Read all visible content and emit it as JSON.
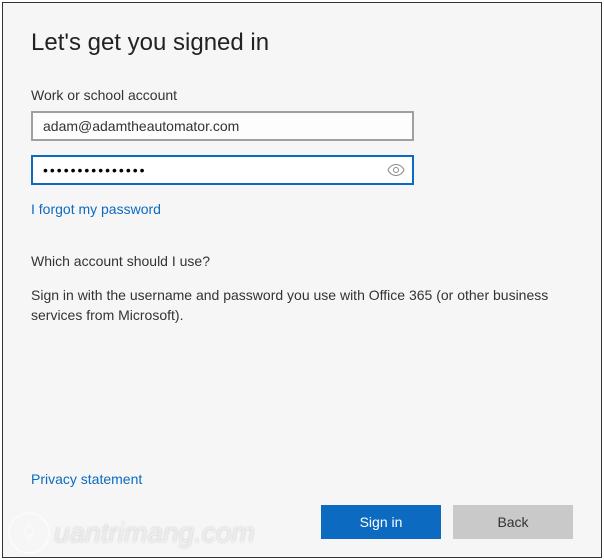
{
  "title": "Let's get you signed in",
  "account_label": "Work or school account",
  "email_value": "adam@adamtheautomator.com",
  "password_value": "•••••••••••••••",
  "forgot_password": "I forgot my password",
  "help_heading": "Which account should I use?",
  "help_text": "Sign in with the username and password you use with Office 365 (or other business services from Microsoft).",
  "privacy_label": "Privacy statement",
  "signin_label": "Sign in",
  "back_label": "Back",
  "watermark_text": "uantrimang.com",
  "colors": {
    "accent": "#0c6bc0",
    "button_secondary": "#c9c9c9"
  }
}
